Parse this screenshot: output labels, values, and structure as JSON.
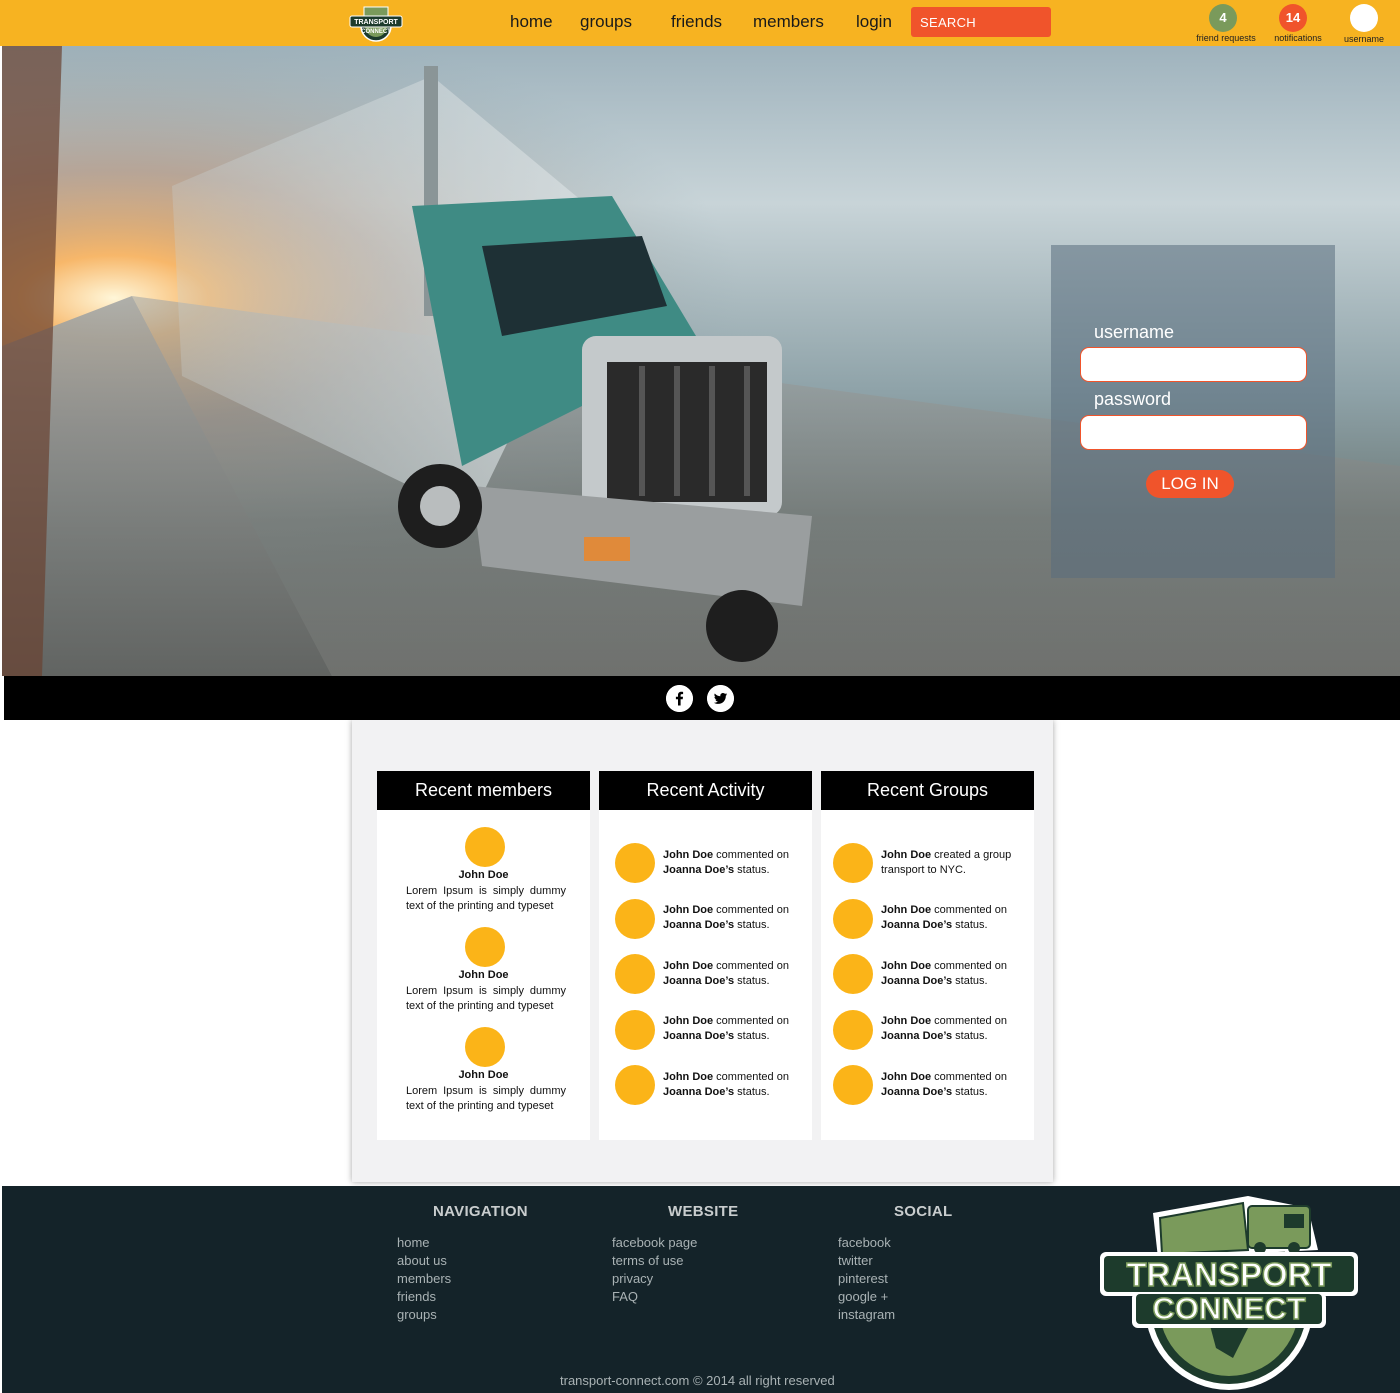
{
  "brand": {
    "logo_text_top": "TRANSPORT",
    "logo_text_bottom": "CONNECT"
  },
  "nav": {
    "home": "home",
    "groups": "groups",
    "friends": "friends",
    "members": "members",
    "login": "login"
  },
  "search": {
    "placeholder": "SEARCH"
  },
  "top_right": {
    "friend_requests_count": "4",
    "friend_requests_label": "friend requests",
    "notifications_count": "14",
    "notifications_label": "notifications",
    "user_label": "username"
  },
  "login": {
    "username_label": "username",
    "password_label": "password",
    "button": "LOG IN"
  },
  "social_strip": {
    "icons": [
      "facebook-icon",
      "twitter-icon"
    ]
  },
  "recent_members": {
    "title": "Recent members",
    "items": [
      {
        "name": "John Doe",
        "desc": "Lorem Ipsum is simply dummy text of the printing and typeset"
      },
      {
        "name": "John Doe",
        "desc": "Lorem Ipsum is simply dummy text of the printing and typeset"
      },
      {
        "name": "John Doe",
        "desc": "Lorem Ipsum is simply dummy text of the printing and typeset"
      }
    ]
  },
  "recent_activity": {
    "title": "Recent Activity",
    "items": [
      {
        "actor": "John Doe",
        "action": " commented on",
        "target": "Joanna Doe’s",
        "rest": " status."
      },
      {
        "actor": "John Doe",
        "action": " commented on",
        "target": "Joanna Doe’s",
        "rest": " status."
      },
      {
        "actor": "John Doe",
        "action": " commented on",
        "target": "Joanna Doe’s",
        "rest": " status."
      },
      {
        "actor": "John Doe",
        "action": " commented on",
        "target": "Joanna Doe’s",
        "rest": " status."
      },
      {
        "actor": "John Doe",
        "action": " commented on",
        "target": "Joanna Doe’s",
        "rest": " status."
      }
    ]
  },
  "recent_groups": {
    "title": "Recent Groups",
    "items": [
      {
        "actor": "John Doe",
        "action": " created a group",
        "target": "",
        "rest": "transport to NYC."
      },
      {
        "actor": "John Doe",
        "action": " commented on",
        "target": "Joanna Doe’s",
        "rest": " status."
      },
      {
        "actor": "John Doe",
        "action": " commented on",
        "target": "Joanna Doe’s",
        "rest": " status."
      },
      {
        "actor": "John Doe",
        "action": " commented on",
        "target": "Joanna Doe’s",
        "rest": " status."
      },
      {
        "actor": "John Doe",
        "action": " commented on",
        "target": "Joanna Doe’s",
        "rest": " status."
      }
    ]
  },
  "footer": {
    "navigation": {
      "title": "NAVIGATION",
      "links": [
        "home",
        "about us",
        "members",
        "friends",
        "groups"
      ]
    },
    "website": {
      "title": "WEBSITE",
      "links": [
        "facebook page",
        "terms of use",
        "privacy",
        "FAQ"
      ]
    },
    "social": {
      "title": "SOCIAL",
      "links": [
        "facebook",
        "twitter",
        "pinterest",
        "google +",
        "instagram"
      ]
    },
    "copyright": "transport-connect.com  © 2014 all right reserved"
  },
  "colors": {
    "accent_yellow": "#f7b321",
    "accent_orange": "#f0542b",
    "avatar_yellow": "#fbb418",
    "footer_bg": "#142329",
    "badge_green": "#7a9a5b"
  }
}
